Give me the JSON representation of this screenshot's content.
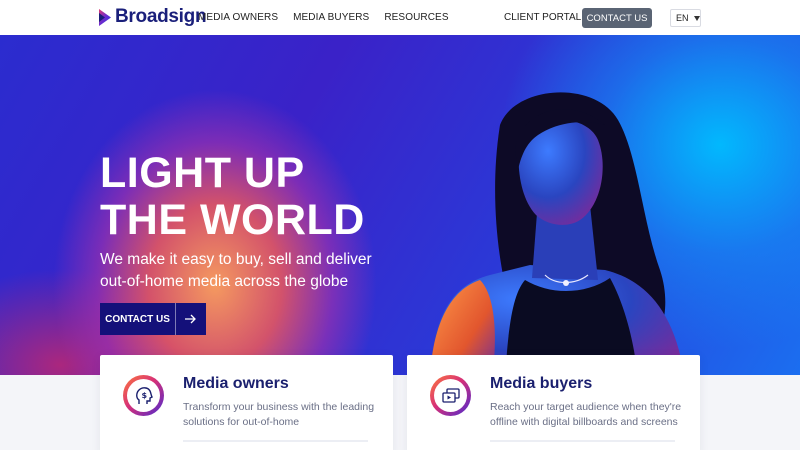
{
  "brand": {
    "name": "Broadsign",
    "accent": "#1a1f7a"
  },
  "nav": {
    "items": [
      {
        "label": "MEDIA OWNERS"
      },
      {
        "label": "MEDIA BUYERS"
      },
      {
        "label": "RESOURCES"
      }
    ],
    "client_portal": "CLIENT PORTAL",
    "contact_label": "CONTACT US",
    "language": "EN"
  },
  "hero": {
    "title_line1": "LIGHT UP",
    "title_line2": "THE WORLD",
    "subtitle": "We make it easy to buy, sell and deliver out-of-home media across the globe",
    "cta_label": "CONTACT US",
    "cta_icon": "arrow-right-icon"
  },
  "cards": [
    {
      "title": "Media owners",
      "description": "Transform your business with the leading solutions for out-of-home",
      "icon": "dollar-head-icon"
    },
    {
      "title": "Media buyers",
      "description": "Reach your target audience when they're offline with digital billboards and screens",
      "icon": "play-screens-icon"
    }
  ]
}
